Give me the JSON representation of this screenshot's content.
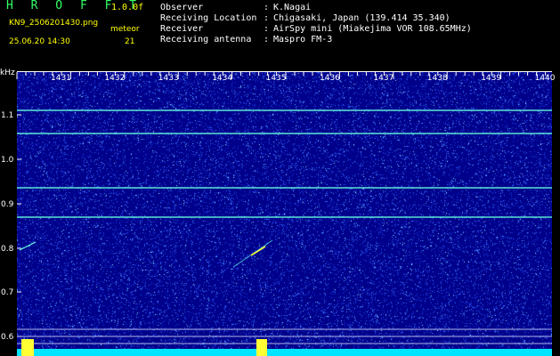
{
  "header": {
    "app_title": "H R O F F T",
    "version": "1.0.0f",
    "filename": "KN9_2506201430.png",
    "datetime": "25.06.20 14:30",
    "meteor_label": "meteor",
    "meteor_count": "21"
  },
  "info": [
    {
      "label": "Observer",
      "value": "K.Nagai"
    },
    {
      "label": "Receiving Location",
      "value": "Chigasaki, Japan (139.414 35.340)"
    },
    {
      "label": "Receiver",
      "value": "AirSpy mini (Miakejima VOR 108.65MHz)"
    },
    {
      "label": "Receiving antenna",
      "value": "Maspro FM-3"
    }
  ],
  "axes": {
    "y_unit": "kHz",
    "y_ticks": [
      "1.1",
      "1.0",
      "0.9",
      "0.8",
      "0.7",
      "0.6"
    ],
    "x_ticks": [
      "1431",
      "1432",
      "1433",
      "1434",
      "1435",
      "1436",
      "1437",
      "1438",
      "1439",
      "1440"
    ]
  },
  "colors": {
    "background": "#00008a",
    "carrier_line": "#66ffdd",
    "floor": "#00e5ff",
    "echo": "#ffff33"
  }
}
